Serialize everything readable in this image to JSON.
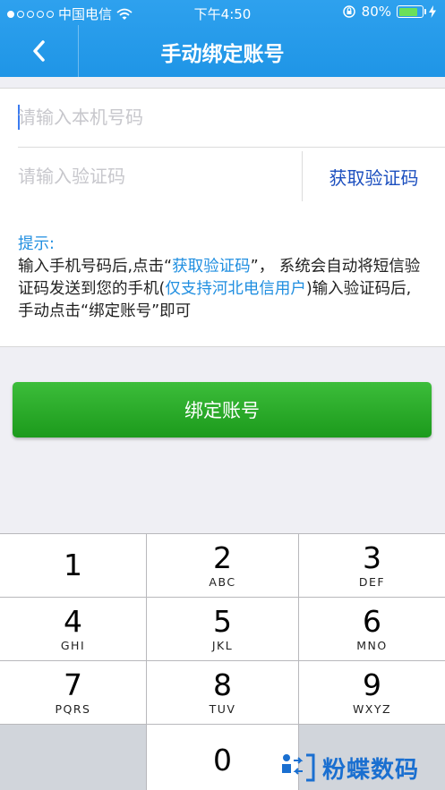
{
  "status_bar": {
    "carrier": "中国电信",
    "time": "下午4:50",
    "battery": "80%",
    "battery_level": 0.8
  },
  "nav": {
    "title": "手动绑定账号"
  },
  "form": {
    "phone_placeholder": "请输入本机号码",
    "phone_value": "",
    "code_placeholder": "请输入验证码",
    "code_value": "",
    "get_code_label": "获取验证码"
  },
  "tip": {
    "title": "提示:",
    "p1": " 输入手机号码后,点击“",
    "p2": "获取验证码",
    "p3": "”， 系统会自动将短信验证码发送到您的手机(",
    "p4": "仅支持河北电信用户",
    "p5": ")输入验证码后,手动点击“绑定账号”即可"
  },
  "bind_button_label": "绑定账号",
  "keypad": {
    "keys": [
      {
        "num": "1",
        "letters": ""
      },
      {
        "num": "2",
        "letters": "ABC"
      },
      {
        "num": "3",
        "letters": "DEF"
      },
      {
        "num": "4",
        "letters": "GHI"
      },
      {
        "num": "5",
        "letters": "JKL"
      },
      {
        "num": "6",
        "letters": "MNO"
      },
      {
        "num": "7",
        "letters": "PQRS"
      },
      {
        "num": "8",
        "letters": "TUV"
      },
      {
        "num": "9",
        "letters": "WXYZ"
      },
      {
        "num": "0",
        "letters": ""
      }
    ]
  },
  "watermark": {
    "text": "粉蝶数码"
  },
  "colors": {
    "header": "#1f95e6",
    "bind_button": "#22a322",
    "link_blue": "#1f8ee0",
    "get_code_text": "#1c4fbf"
  }
}
